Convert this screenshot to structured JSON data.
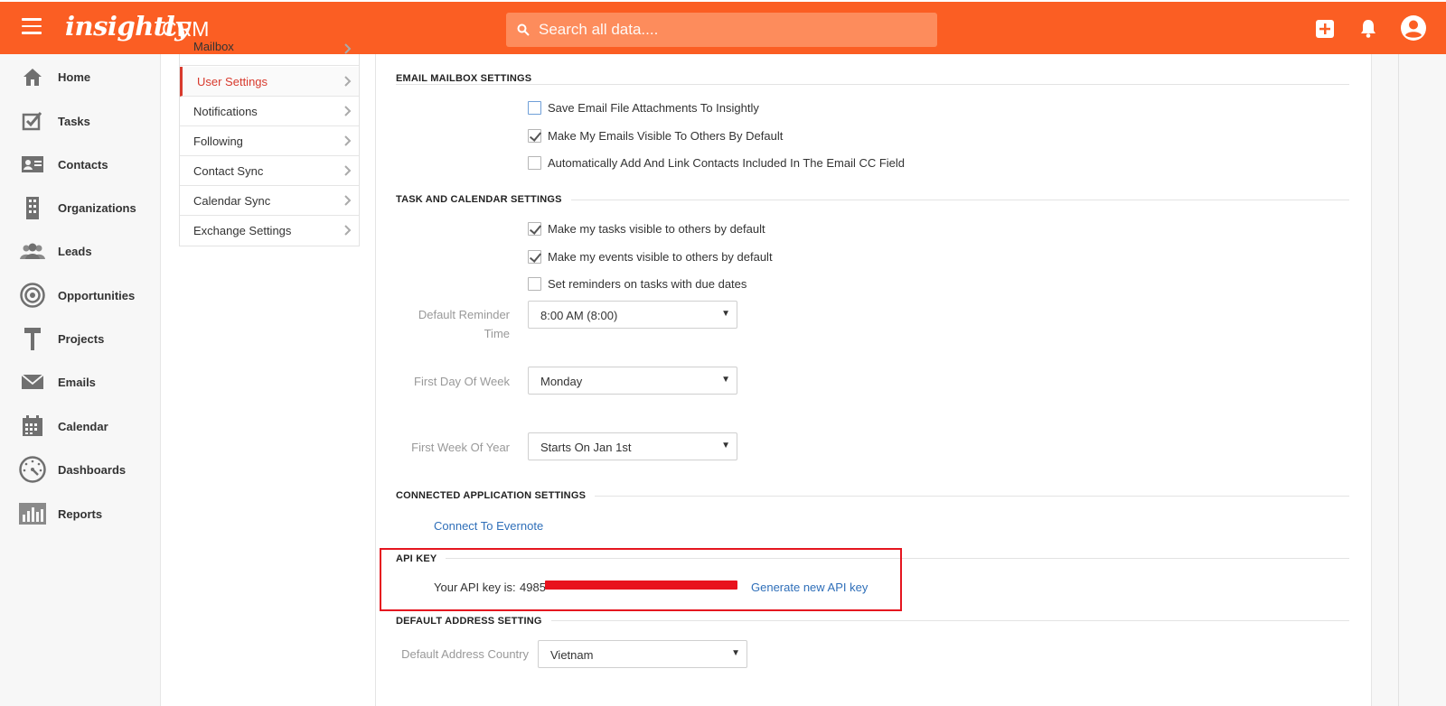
{
  "header": {
    "brand": "insightly",
    "product": "CRM",
    "search_placeholder": "Search all data...."
  },
  "nav": [
    {
      "label": "Home",
      "icon": "home-icon"
    },
    {
      "label": "Tasks",
      "icon": "tasks-icon"
    },
    {
      "label": "Contacts",
      "icon": "contacts-icon"
    },
    {
      "label": "Organizations",
      "icon": "organizations-icon"
    },
    {
      "label": "Leads",
      "icon": "leads-icon"
    },
    {
      "label": "Opportunities",
      "icon": "opportunities-icon"
    },
    {
      "label": "Projects",
      "icon": "projects-icon"
    },
    {
      "label": "Emails",
      "icon": "emails-icon"
    },
    {
      "label": "Calendar",
      "icon": "calendar-icon"
    },
    {
      "label": "Dashboards",
      "icon": "dashboards-icon"
    },
    {
      "label": "Reports",
      "icon": "reports-icon"
    }
  ],
  "submenu": {
    "partial": "Mailbox",
    "items": [
      "User Settings",
      "Notifications",
      "Following",
      "Contact Sync",
      "Calendar Sync",
      "Exchange Settings"
    ],
    "active": "User Settings"
  },
  "email_mailbox": {
    "title": "EMAIL MAILBOX SETTINGS",
    "options": [
      {
        "label": "Save Email File Attachments To Insightly",
        "checked": false
      },
      {
        "label": "Make My Emails Visible To Others By Default",
        "checked": true
      },
      {
        "label": "Automatically Add And Link Contacts Included In The Email CC Field",
        "checked": false
      }
    ]
  },
  "task_calendar": {
    "title": "TASK AND CALENDAR SETTINGS",
    "options": [
      {
        "label": "Make my tasks visible to others by default",
        "checked": true
      },
      {
        "label": "Make my events visible to others by default",
        "checked": true
      },
      {
        "label": "Set reminders on tasks with due dates",
        "checked": false
      }
    ],
    "reminder_label_line1": "Default Reminder",
    "reminder_label_line2": "Time",
    "reminder_value": "8:00 AM (8:00)",
    "first_day_label": "First Day Of Week",
    "first_day_value": "Monday",
    "first_week_label": "First Week Of Year",
    "first_week_value": "Starts On Jan 1st"
  },
  "connected_apps": {
    "title": "CONNECTED APPLICATION SETTINGS",
    "evernote_link": "Connect To Evernote"
  },
  "api_key": {
    "title": "API KEY",
    "label": "Your API key is:",
    "value_visible": "4985",
    "generate_link": "Generate new API key"
  },
  "default_address": {
    "title": "DEFAULT ADDRESS SETTING",
    "country_label": "Default Address Country",
    "country_value": "Vietnam"
  },
  "colors": {
    "header": "#fb5e23",
    "active": "#d83a2d",
    "link": "#2f6fb9",
    "highlight": "#e5151f"
  }
}
